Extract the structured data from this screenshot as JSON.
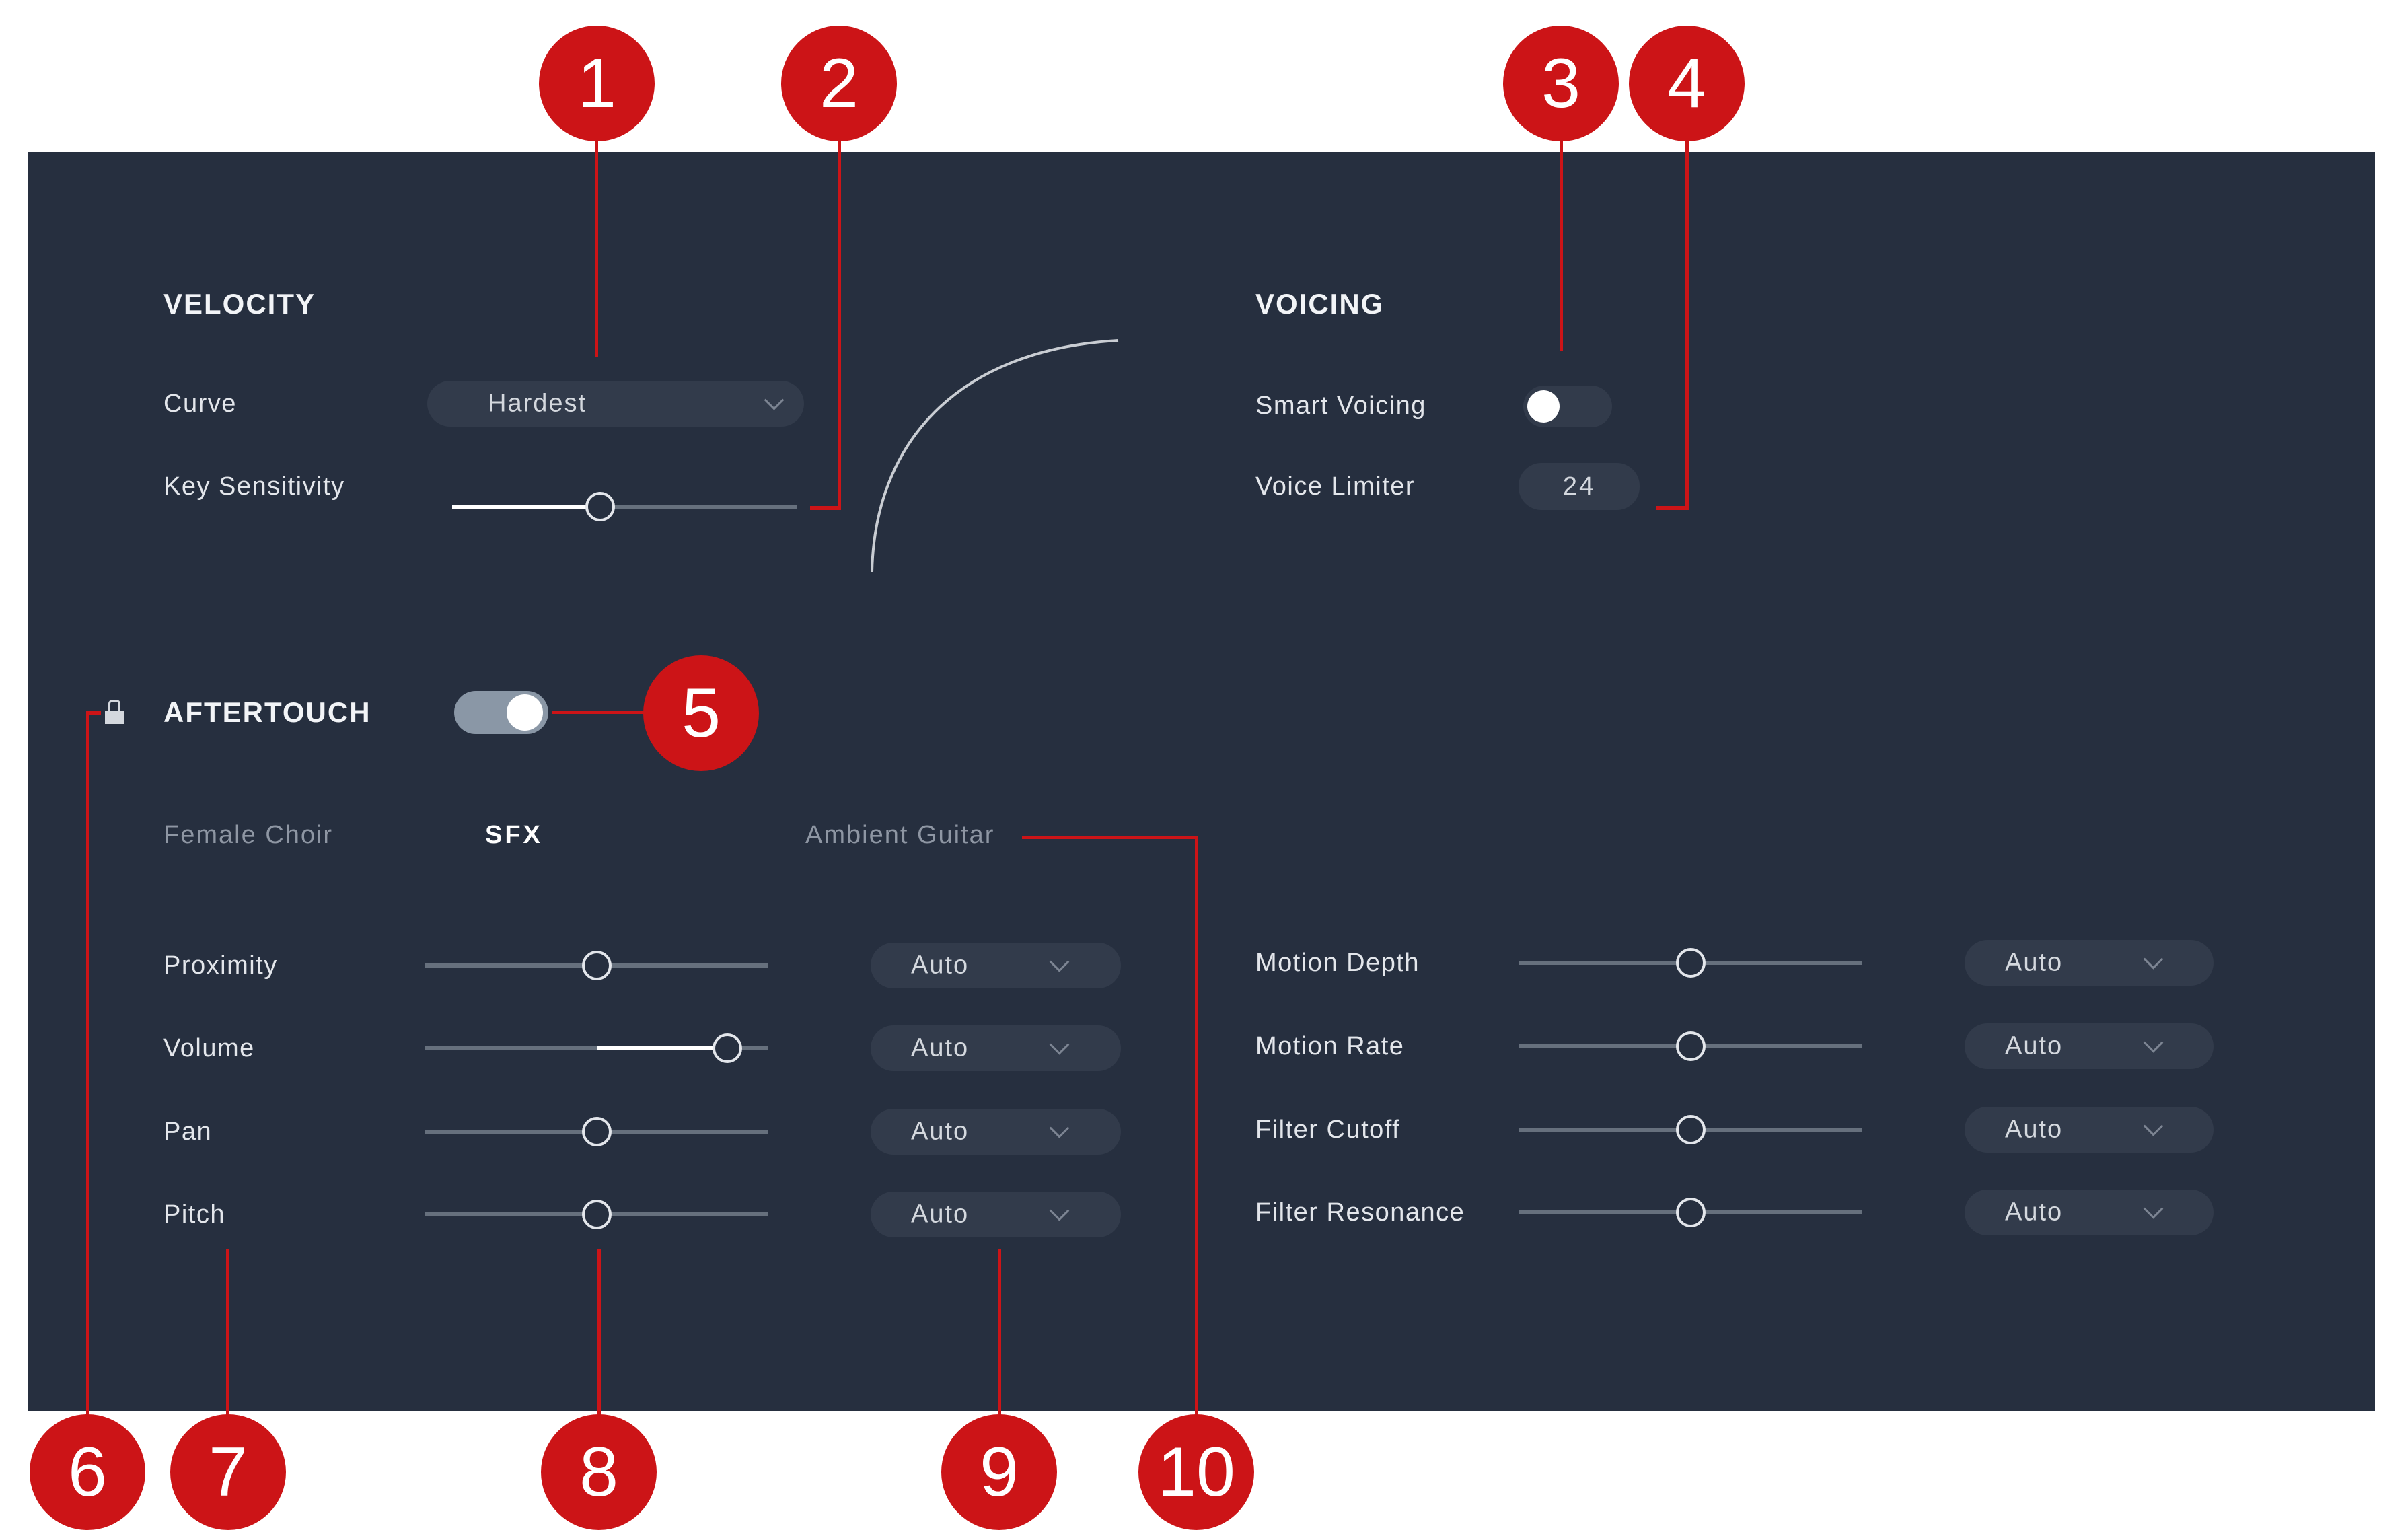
{
  "velocity": {
    "title": "VELOCITY",
    "curve_label": "Curve",
    "curve_value": "Hardest",
    "key_sensitivity_label": "Key Sensitivity",
    "key_sensitivity_value": 0.43
  },
  "voicing": {
    "title": "VOICING",
    "smart_voicing_label": "Smart Voicing",
    "smart_voicing_on": false,
    "voice_limiter_label": "Voice Limiter",
    "voice_limiter_value": "24"
  },
  "aftertouch": {
    "title": "AFTERTOUCH",
    "enabled": true,
    "lock_icon": "lock-icon",
    "tabs": [
      {
        "label": "Female Choir",
        "active": false
      },
      {
        "label": "SFX",
        "active": true
      },
      {
        "label": "Ambient Guitar",
        "active": false
      }
    ],
    "left_params": [
      {
        "label": "Proximity",
        "value": 0.5,
        "bipolar": false,
        "mode": "Auto"
      },
      {
        "label": "Volume",
        "value": 0.88,
        "bipolar": true,
        "mode": "Auto"
      },
      {
        "label": "Pan",
        "value": 0.5,
        "bipolar": false,
        "mode": "Auto"
      },
      {
        "label": "Pitch",
        "value": 0.5,
        "bipolar": false,
        "mode": "Auto"
      }
    ],
    "right_params": [
      {
        "label": "Motion Depth",
        "value": 0.5,
        "mode": "Auto"
      },
      {
        "label": "Motion Rate",
        "value": 0.5,
        "mode": "Auto"
      },
      {
        "label": "Filter Cutoff",
        "value": 0.5,
        "mode": "Auto"
      },
      {
        "label": "Filter Resonance",
        "value": 0.5,
        "mode": "Auto"
      }
    ]
  },
  "callouts": [
    "1",
    "2",
    "3",
    "4",
    "5",
    "6",
    "7",
    "8",
    "9",
    "10"
  ],
  "colors": {
    "panel": "#262f3f",
    "control_bg": "#323b4b",
    "callout": "#cc1417",
    "track": "#66707d",
    "toggle_on": "#8a97a6"
  }
}
